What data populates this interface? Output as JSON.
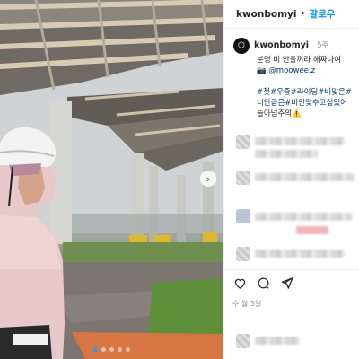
{
  "post": {
    "username": "kwonbomyi",
    "separator": "•",
    "follow_label": "팔로우"
  },
  "caption": {
    "username": "kwonbomyi",
    "time": "5주",
    "line1": "분명 비 안올꺼라 해짜나여",
    "tag_prefix": "📷",
    "tag": "@moowee.z",
    "hashtags_line1": "#첫#우중#라이딩#비맞은#",
    "hashtags_line2": "너만큼은#비안맞추고싶었어",
    "hashtags_line3": "늘아넘주의⚠️"
  },
  "likes_blurred": "수 월 3일",
  "icons": {
    "next": "chevron-right-icon",
    "like": "heart-icon",
    "comment": "comment-icon",
    "share": "paper-plane-icon"
  },
  "carousel": {
    "count": 5,
    "active_index": 0
  }
}
